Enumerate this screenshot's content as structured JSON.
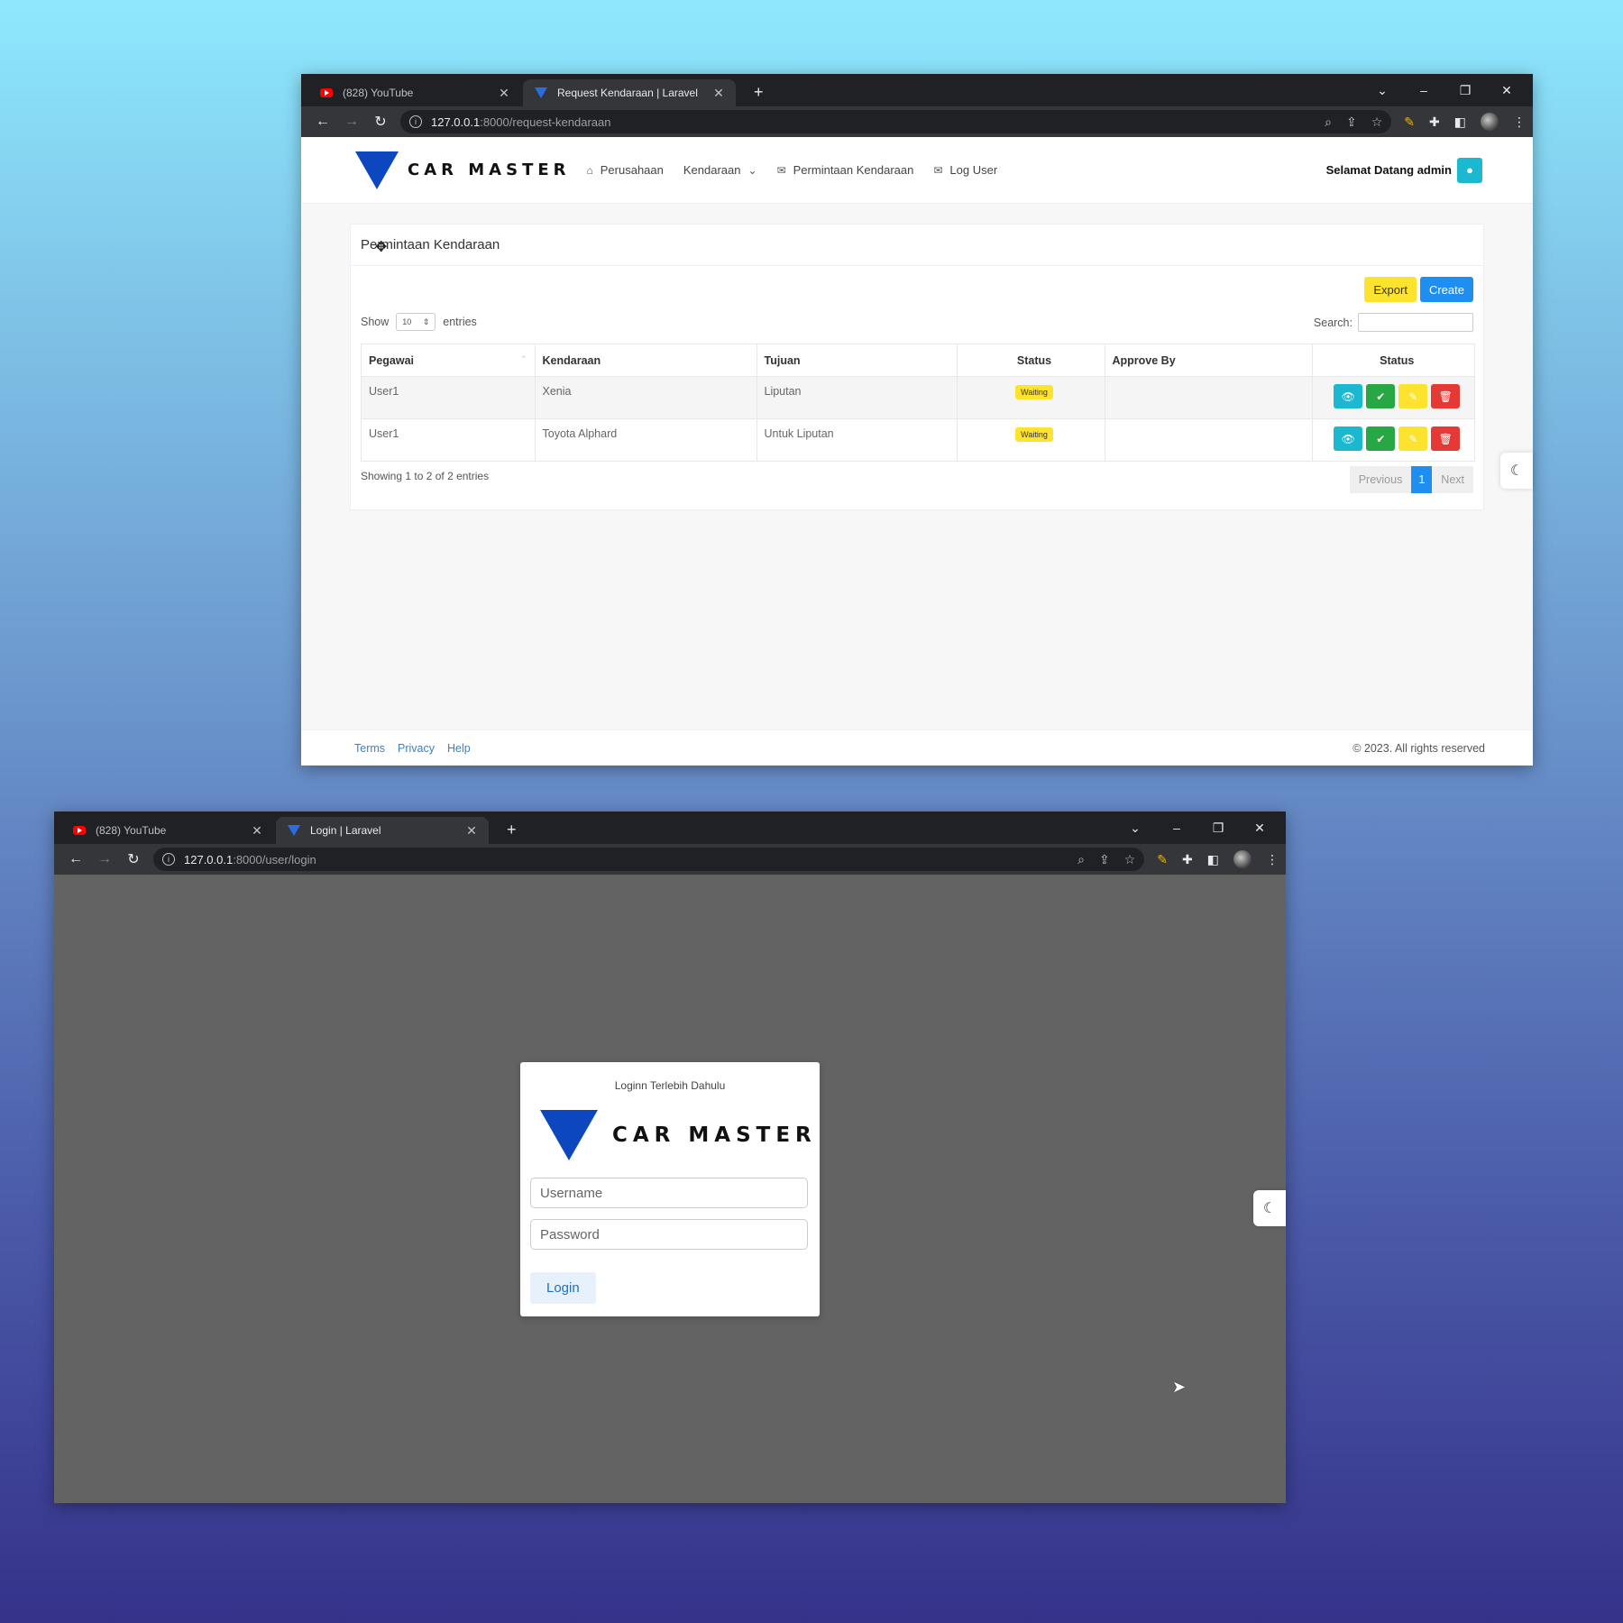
{
  "top_window": {
    "tabs": [
      {
        "title": "(828) YouTube",
        "favicon": "youtube-icon"
      },
      {
        "title": "Request Kendaraan | Laravel",
        "favicon": "carmaster-icon"
      }
    ],
    "url_host": "127.0.0.1",
    "url_rest": ":8000/request-kendaraan",
    "app": {
      "brand": "CAR MASTER",
      "menu": [
        {
          "label": "Perusahaan",
          "icon": "home-icon"
        },
        {
          "label": "Kendaraan",
          "icon": "chevron-down-icon"
        },
        {
          "label": "Permintaan Kendaraan",
          "icon": "envelope-icon"
        },
        {
          "label": "Log User",
          "icon": "envelope-icon"
        }
      ],
      "welcome": "Selamat Datang admin",
      "card_title": "Permintaan Kendaraan",
      "export_label": "Export",
      "create_label": "Create",
      "show_label": "Show",
      "entries_value": "10",
      "entries_label": "entries",
      "search_label": "Search:",
      "columns": [
        "Pegawai",
        "Kendaraan",
        "Tujuan",
        "Status",
        "Approve By",
        "Status"
      ],
      "rows": [
        {
          "pegawai": "User1",
          "kendaraan": "Xenia",
          "tujuan": "Liputan",
          "status": "Waiting",
          "approve_by": ""
        },
        {
          "pegawai": "User1",
          "kendaraan": "Toyota Alphard",
          "tujuan": "Untuk Liputan",
          "status": "Waiting",
          "approve_by": ""
        }
      ],
      "showing_text": "Showing 1 to 2 of 2 entries",
      "pagination": {
        "prev": "Previous",
        "current": "1",
        "next": "Next"
      },
      "footer": {
        "links": [
          "Terms",
          "Privacy",
          "Help"
        ],
        "copyright": "© 2023. All rights reserved"
      }
    }
  },
  "bottom_window": {
    "tabs": [
      {
        "title": "(828) YouTube",
        "favicon": "youtube-icon"
      },
      {
        "title": "Login | Laravel",
        "favicon": "carmaster-icon"
      }
    ],
    "url_host": "127.0.0.1",
    "url_rest": ":8000/user/login",
    "login": {
      "heading": "Loginn Terlebih Dahulu",
      "brand": "CAR MASTER",
      "username_placeholder": "Username",
      "password_placeholder": "Password",
      "button": "Login"
    }
  },
  "colors": {
    "brand_blue": "#0d47bf",
    "warning_yellow": "#fde32d",
    "primary_blue": "#1f8ef1",
    "info_cyan": "#1bb8d0",
    "success_green": "#28a745",
    "danger_red": "#e53935"
  }
}
